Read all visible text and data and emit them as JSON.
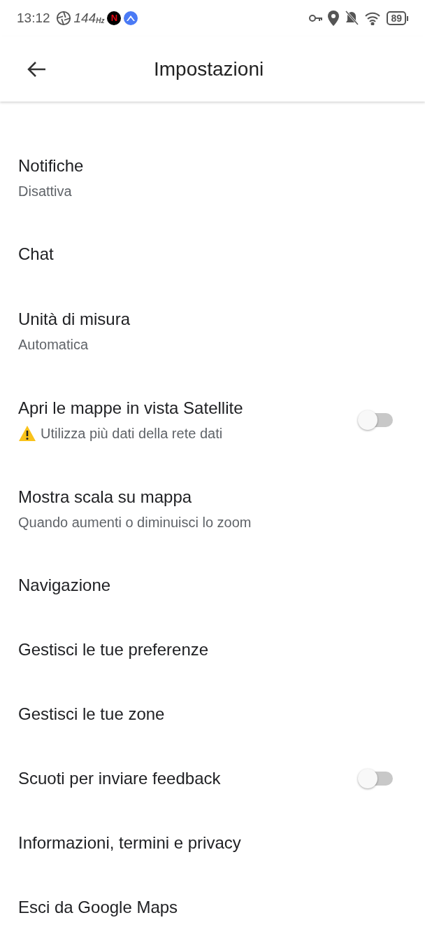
{
  "status_bar": {
    "time": "13:12",
    "refresh_rate": "144",
    "refresh_unit": "Hz",
    "app_badge": "N",
    "battery": "89"
  },
  "header": {
    "title": "Impostazioni"
  },
  "items": [
    {
      "kind": "link",
      "title": "Notifiche",
      "subtitle": "Disattiva"
    },
    {
      "kind": "link",
      "title": "Chat"
    },
    {
      "kind": "link",
      "title": "Unità di misura",
      "subtitle": "Automatica"
    },
    {
      "kind": "toggle",
      "title": "Apri le mappe in vista Satellite",
      "subtitle": "Utilizza più dati della rete dati",
      "warning": true,
      "on": false
    },
    {
      "kind": "link",
      "title": "Mostra scala su mappa",
      "subtitle": "Quando aumenti o diminuisci lo zoom"
    },
    {
      "kind": "link",
      "title": "Navigazione"
    },
    {
      "kind": "link",
      "title": "Gestisci le tue preferenze"
    },
    {
      "kind": "link",
      "title": "Gestisci le tue zone"
    },
    {
      "kind": "toggle",
      "title": "Scuoti per inviare feedback",
      "on": false
    },
    {
      "kind": "link",
      "title": "Informazioni, termini e privacy"
    },
    {
      "kind": "link",
      "title": "Esci da Google Maps"
    }
  ]
}
